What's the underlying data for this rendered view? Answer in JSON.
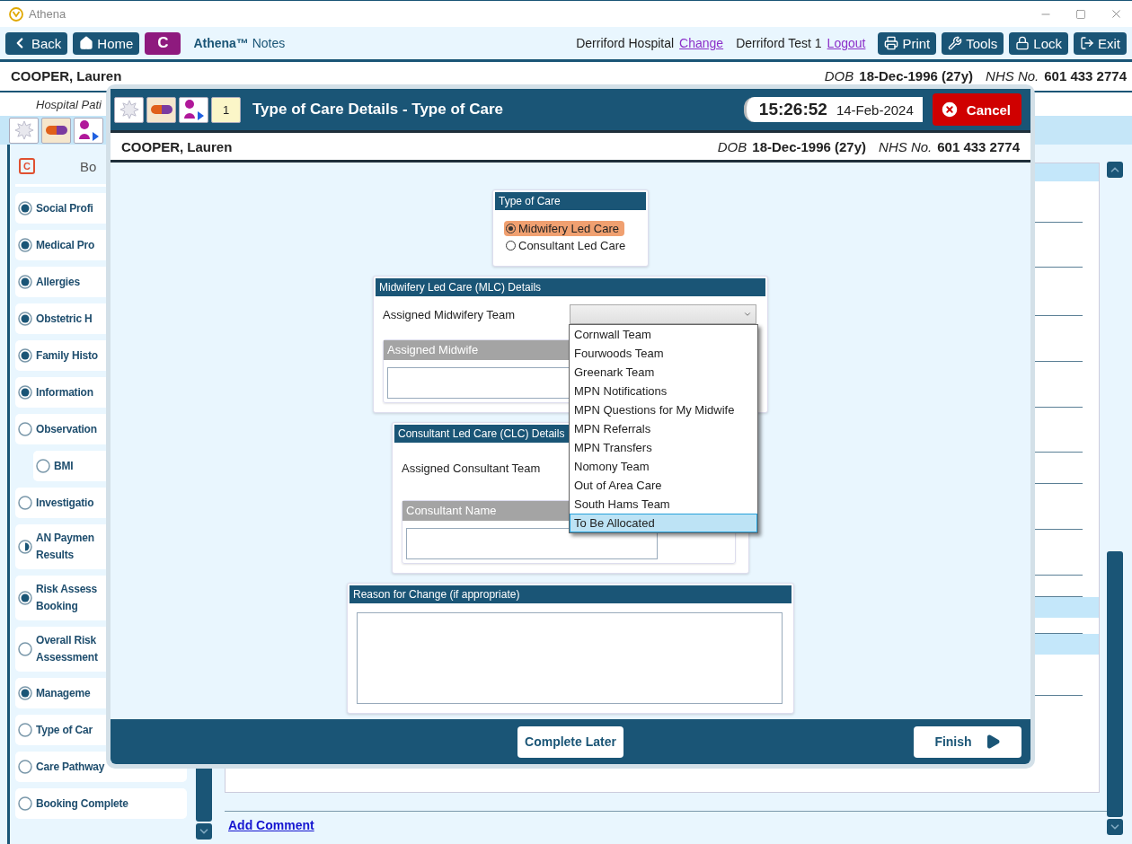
{
  "window": {
    "title": "Athena"
  },
  "toolbar": {
    "back": "Back",
    "home": "Home",
    "c_button": "C",
    "app_name": "**Athena™** Notes",
    "hospital": "Derriford Hospital",
    "change_link": "Change",
    "user": "Derriford Test 1",
    "logout_link": "Logout",
    "buttons": [
      {
        "kind": "print",
        "label": "Print"
      },
      {
        "kind": "tools",
        "label": "Tools"
      },
      {
        "kind": "lock",
        "label": "Lock"
      },
      {
        "kind": "exit",
        "label": "Exit"
      }
    ]
  },
  "patient": {
    "name": "COOPER, Lauren",
    "dob_label": "DOB",
    "dob": "18-Dec-1996 (27y)",
    "nhs_label": "NHS No.",
    "nhs": "601 433 2774"
  },
  "sub_bar": {
    "text": "Hospital Pati"
  },
  "sidebar": {
    "badge": "C",
    "heading": "Bo",
    "items": [
      {
        "lines": [
          "Social Profi"
        ],
        "complete": true,
        "partial": false
      },
      {
        "lines": [
          "Medical Pro"
        ],
        "complete": true,
        "partial": false
      },
      {
        "lines": [
          "Allergies"
        ],
        "complete": true,
        "partial": false
      },
      {
        "lines": [
          "Obstetric H"
        ],
        "complete": true,
        "partial": false
      },
      {
        "lines": [
          "Family Histo"
        ],
        "complete": true,
        "partial": false
      },
      {
        "lines": [
          "Information"
        ],
        "complete": true,
        "partial": false
      },
      {
        "lines": [
          "Observation"
        ],
        "complete": false,
        "partial": false,
        "children": [
          {
            "lines": [
              "BMI"
            ],
            "complete": false,
            "partial": false
          }
        ]
      },
      {
        "lines": [
          "Investigatio"
        ],
        "complete": false,
        "partial": false
      },
      {
        "lines": [
          "AN Paymen",
          "Results"
        ],
        "complete": false,
        "partial": true
      },
      {
        "lines": [
          "Risk Assess",
          "Booking"
        ],
        "complete": true,
        "partial": false
      },
      {
        "lines": [
          "Overall Risk",
          "Assessment"
        ],
        "complete": false,
        "partial": false
      },
      {
        "lines": [
          "Manageme"
        ],
        "complete": true,
        "partial": false
      },
      {
        "lines": [
          "Type of Car"
        ],
        "complete": false,
        "partial": false
      },
      {
        "lines": [
          "Care Pathway"
        ],
        "complete": false,
        "partial": false
      },
      {
        "lines": [
          "Booking Complete"
        ],
        "complete": false,
        "partial": false
      }
    ]
  },
  "add_comment": "Add Comment",
  "dialog": {
    "title": "Type of Care Details - Type of Care",
    "notes_badge": "1",
    "time": "15:26:52",
    "date": "14-Feb-2024",
    "cancel": "Cancel",
    "patient": {
      "name": "COOPER, Lauren",
      "dob_label": "DOB",
      "dob": "18-Dec-1996 (27y)",
      "nhs_label": "NHS No.",
      "nhs": "601 433 2774"
    },
    "type_of_care": {
      "title": "Type of Care",
      "options": [
        {
          "label": "Midwifery Led Care",
          "selected": true
        },
        {
          "label": "Consultant Led Care",
          "selected": false
        }
      ]
    },
    "mlc": {
      "title": "Midwifery Led Care (MLC) Details",
      "team_label": "Assigned Midwifery Team",
      "expanded": true,
      "midwife_label": "Assigned Midwife",
      "team_options": [
        {
          "label": "Cornwall Team",
          "selected": false
        },
        {
          "label": "Fourwoods Team",
          "selected": false
        },
        {
          "label": "Greenark Team",
          "selected": false
        },
        {
          "label": "MPN Notifications",
          "selected": false
        },
        {
          "label": "MPN Questions for My Midwife",
          "selected": false
        },
        {
          "label": "MPN Referrals",
          "selected": false
        },
        {
          "label": "MPN Transfers",
          "selected": false
        },
        {
          "label": "Nomony Team",
          "selected": false
        },
        {
          "label": "Out of Area Care",
          "selected": false
        },
        {
          "label": "South Hams Team",
          "selected": false
        },
        {
          "label": "To Be Allocated",
          "selected": true
        }
      ]
    },
    "clc": {
      "title": "Consultant Led Care (CLC) Details",
      "team_label": "Assigned Consultant Team",
      "consultant_label": "Consultant Name"
    },
    "reason": {
      "title": "Reason for Change (if appropriate)"
    },
    "complete_later": "Complete Later",
    "finish": "Finish"
  }
}
